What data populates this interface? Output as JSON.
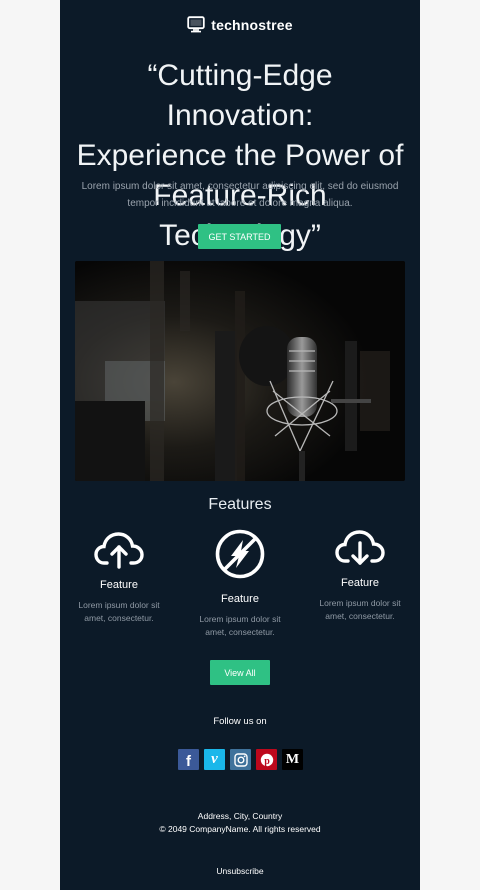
{
  "brand": {
    "name": "technostree",
    "icon": "monitor-icon"
  },
  "hero": {
    "title_line1": "“Cutting-Edge Innovation:",
    "title_line2": "Experience the Power of",
    "title_line3": "Feature-Rich Technology”",
    "text_line1": "Lorem ipsum dolor sit amet, consectetur adipiscing elit, sed do eiusmod",
    "text_line2": "tempor incididunt ut labore et dolore magna aliqua.",
    "cta_label": "GET STARTED",
    "image": "microphone-photo"
  },
  "features": {
    "title": "Features",
    "items": [
      {
        "icon": "cloud-upload-icon",
        "name": "Feature",
        "desc_line1": "Lorem ipsum dolor sit",
        "desc_line2": "amet, consectetur."
      },
      {
        "icon": "no-power-icon",
        "name": "Feature",
        "desc_line1": "Lorem ipsum dolor sit",
        "desc_line2": "amet, consectetur."
      },
      {
        "icon": "cloud-download-icon",
        "name": "Feature",
        "desc_line1": "Lorem ipsum dolor sit",
        "desc_line2": "amet, consectetur."
      }
    ],
    "view_all_label": "View All"
  },
  "social": {
    "title": "Follow us on",
    "items": [
      {
        "name": "facebook",
        "glyph": "f",
        "color": "#3b5998"
      },
      {
        "name": "vimeo",
        "glyph": "v",
        "color": "#1ab7ea"
      },
      {
        "name": "instagram",
        "glyph": "",
        "color": "#3f729b"
      },
      {
        "name": "pinterest",
        "glyph": "P",
        "color": "#bd081c"
      },
      {
        "name": "medium",
        "glyph": "M",
        "color": "#000000"
      }
    ]
  },
  "footer": {
    "address": "Address, City, Country",
    "copyright": "© 2049 CompanyName. All rights reserved",
    "unsubscribe": "Unsubscribe"
  },
  "colors": {
    "background": "#0c1a28",
    "accent": "#2fc184",
    "page": "#f6f6f6"
  }
}
